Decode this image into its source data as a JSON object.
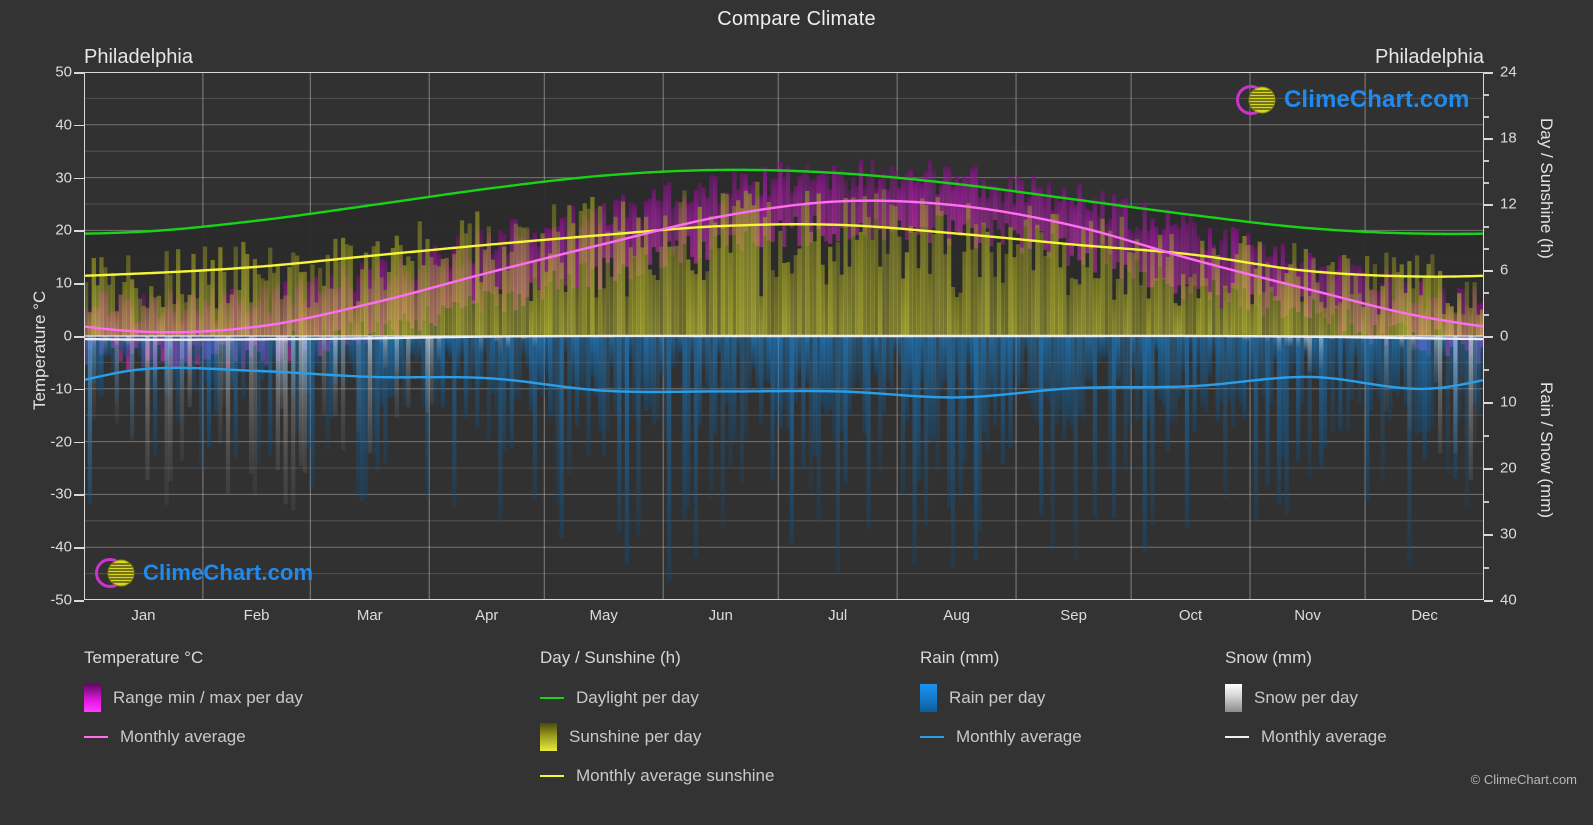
{
  "title": "Compare Climate",
  "station_left": "Philadelphia",
  "station_right": "Philadelphia",
  "copyright": "© ClimeChart.com",
  "logo_text": "ClimeChart.com",
  "axes": {
    "left_title": "Temperature °C",
    "right_title_top": "Day / Sunshine (h)",
    "right_title_bottom": "Rain / Snow (mm)",
    "left_ticks": [
      "50",
      "40",
      "30",
      "20",
      "10",
      "0",
      "-10",
      "-20",
      "-30",
      "-40",
      "-50"
    ],
    "left_range": [
      -50,
      50
    ],
    "right_top_ticks": [
      "24",
      "18",
      "12",
      "6",
      "0"
    ],
    "right_top_range": [
      0,
      24
    ],
    "right_bottom_ticks": [
      "0",
      "10",
      "20",
      "30",
      "40"
    ],
    "right_bottom_range": [
      0,
      40
    ],
    "x_ticks": [
      "Jan",
      "Feb",
      "Mar",
      "Apr",
      "May",
      "Jun",
      "Jul",
      "Aug",
      "Sep",
      "Oct",
      "Nov",
      "Dec"
    ]
  },
  "legend": {
    "groups": [
      {
        "heading": "Temperature °C",
        "items": [
          {
            "label": "Range min / max per day",
            "marker": "gradient",
            "color": "#cc00cc"
          },
          {
            "label": "Monthly average",
            "marker": "line",
            "color": "#ff6ef0"
          }
        ]
      },
      {
        "heading": "Day / Sunshine (h)",
        "items": [
          {
            "label": "Daylight per day",
            "marker": "line",
            "color": "#18d318"
          },
          {
            "label": "Sunshine per day",
            "marker": "gradient",
            "color": "#f2f23c"
          },
          {
            "label": "Monthly average sunshine",
            "marker": "line",
            "color": "#f5f53a"
          }
        ]
      },
      {
        "heading": "Rain (mm)",
        "items": [
          {
            "label": "Rain per day",
            "marker": "gradient",
            "color": "#1188e8"
          },
          {
            "label": "Monthly average",
            "marker": "line",
            "color": "#2a9fe8"
          }
        ]
      },
      {
        "heading": "Snow (mm)",
        "items": [
          {
            "label": "Snow per day",
            "marker": "gradient",
            "color": "#ffffff"
          },
          {
            "label": "Monthly average",
            "marker": "line",
            "color": "#f0f0f0"
          }
        ]
      }
    ]
  },
  "colors": {
    "background": "#333333",
    "plot_background": "#313131",
    "grid": "#d2d2d2",
    "text": "#dcdcdc",
    "daylight": "#18d318",
    "sunshine_avg": "#f5f53a",
    "sunshine_fill": "#c8c832",
    "temp_avg": "#ff6ef0",
    "temp_range": "#cc00cc",
    "rain": "#1188e8",
    "rain_avg": "#2a9fe8",
    "snow": "#ffffff",
    "snow_avg": "#f0f0f0",
    "logo_blue": "#1f8bef",
    "logo_magenta": "#cc33cc",
    "logo_yellow": "#d8d820"
  },
  "chart_data": {
    "type": "area",
    "title": "Compare Climate",
    "subtitle": "Philadelphia",
    "xlabel": "",
    "ylabel": "Temperature °C",
    "ylim": [
      -50,
      50
    ],
    "y2lim_top": [
      0,
      24
    ],
    "y2lim_bottom": [
      0,
      40
    ],
    "grid": true,
    "legend_position": "bottom",
    "categories": [
      "Jan",
      "Feb",
      "Mar",
      "Apr",
      "May",
      "Jun",
      "Jul",
      "Aug",
      "Sep",
      "Oct",
      "Nov",
      "Dec"
    ],
    "series": [
      {
        "name": "Daylight per day",
        "unit": "h",
        "axis": "right-top",
        "color": "#18d318",
        "values": [
          9.5,
          10.5,
          11.9,
          13.4,
          14.6,
          15.1,
          14.8,
          13.8,
          12.4,
          11.0,
          9.8,
          9.3
        ]
      },
      {
        "name": "Monthly average sunshine",
        "unit": "h",
        "axis": "right-top",
        "color": "#f5f53a",
        "values": [
          5.7,
          6.3,
          7.3,
          8.3,
          9.2,
          10.0,
          10.1,
          9.3,
          8.3,
          7.4,
          5.9,
          5.4
        ]
      },
      {
        "name": "Monthly average temperature",
        "unit": "°C",
        "axis": "left",
        "color": "#ff6ef0",
        "values": [
          0.8,
          1.8,
          6.2,
          12.0,
          17.5,
          22.7,
          25.5,
          24.7,
          20.8,
          14.5,
          8.8,
          3.5
        ]
      },
      {
        "name": "Range min per day (monthly mean minimum)",
        "unit": "°C",
        "axis": "left",
        "color": "#cc00cc",
        "values": [
          -3.5,
          -2.6,
          1.4,
          6.8,
          12.3,
          17.8,
          20.8,
          20.2,
          16.2,
          9.8,
          4.6,
          -0.6
        ]
      },
      {
        "name": "Range max per day (monthly mean maximum)",
        "unit": "°C",
        "axis": "left",
        "color": "#cc00cc",
        "values": [
          5.1,
          6.3,
          11.0,
          17.2,
          22.6,
          27.6,
          30.2,
          29.2,
          25.4,
          19.2,
          13.0,
          7.6
        ]
      },
      {
        "name": "Rain monthly average",
        "unit": "mm",
        "axis": "right-bottom",
        "color": "#2a9fe8",
        "values": [
          5.0,
          5.3,
          6.2,
          6.4,
          8.3,
          8.4,
          8.4,
          9.3,
          7.9,
          7.6,
          6.2,
          8.0
        ]
      },
      {
        "name": "Snow monthly average",
        "unit": "mm",
        "axis": "right-bottom",
        "color": "#f0f0f0",
        "values": [
          0.55,
          0.5,
          0.35,
          0.08,
          0.0,
          0.0,
          0.0,
          0.0,
          0.0,
          0.0,
          0.1,
          0.35
        ]
      }
    ]
  }
}
